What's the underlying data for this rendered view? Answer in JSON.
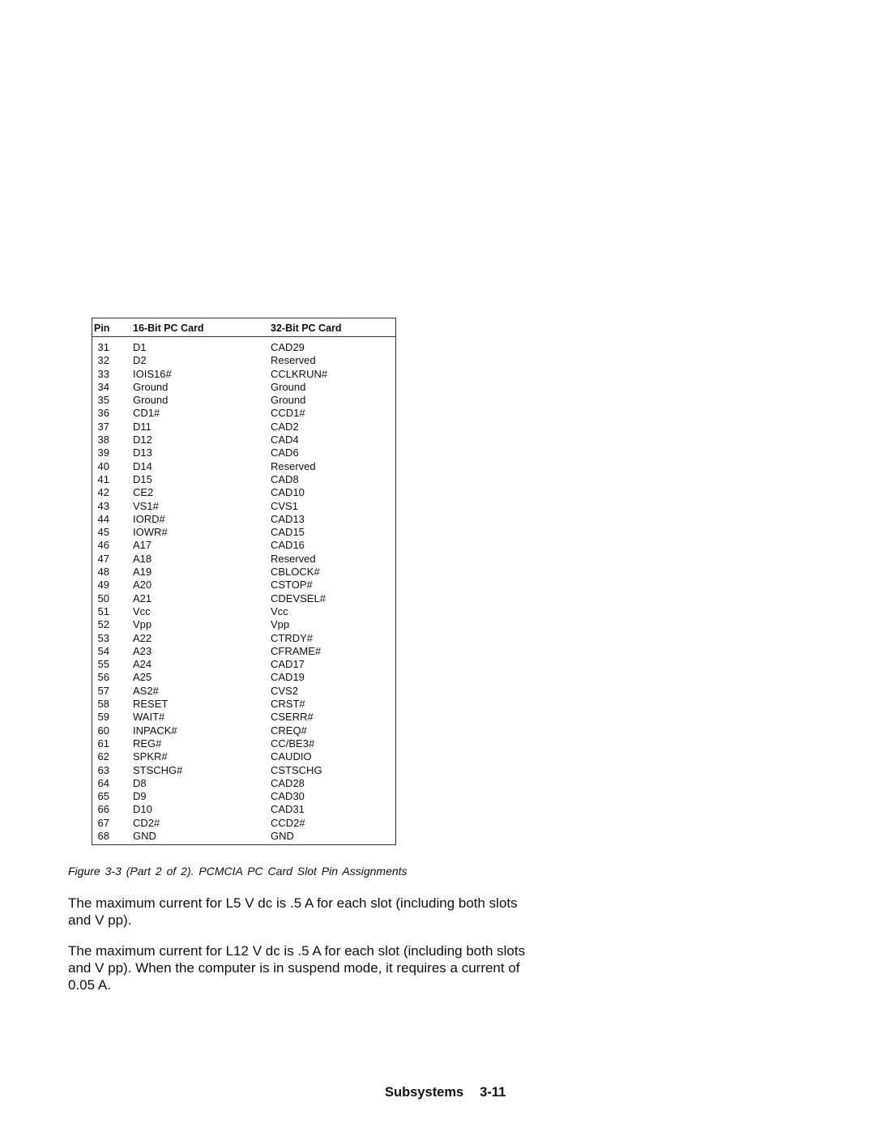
{
  "table": {
    "headers": {
      "pin": "Pin",
      "bit16": "16-Bit PC Card",
      "bit32": "32-Bit PC Card"
    },
    "rows": [
      {
        "pin": "31",
        "bit16": "D1",
        "bit32": "CAD29"
      },
      {
        "pin": "32",
        "bit16": "D2",
        "bit32": "Reserved"
      },
      {
        "pin": "33",
        "bit16": "IOIS16#",
        "bit32": "CCLKRUN#"
      },
      {
        "pin": "34",
        "bit16": "Ground",
        "bit32": "Ground"
      },
      {
        "pin": "35",
        "bit16": "Ground",
        "bit32": "Ground"
      },
      {
        "pin": "36",
        "bit16": "CD1#",
        "bit32": "CCD1#"
      },
      {
        "pin": "37",
        "bit16": "D11",
        "bit32": "CAD2"
      },
      {
        "pin": "38",
        "bit16": "D12",
        "bit32": "CAD4"
      },
      {
        "pin": "39",
        "bit16": "D13",
        "bit32": "CAD6"
      },
      {
        "pin": "40",
        "bit16": "D14",
        "bit32": "Reserved"
      },
      {
        "pin": "41",
        "bit16": "D15",
        "bit32": "CAD8"
      },
      {
        "pin": "42",
        "bit16": "CE2",
        "bit32": "CAD10"
      },
      {
        "pin": "43",
        "bit16": "VS1#",
        "bit32": "CVS1"
      },
      {
        "pin": "44",
        "bit16": "IORD#",
        "bit32": "CAD13"
      },
      {
        "pin": "45",
        "bit16": "IOWR#",
        "bit32": "CAD15"
      },
      {
        "pin": "46",
        "bit16": "A17",
        "bit32": "CAD16"
      },
      {
        "pin": "47",
        "bit16": "A18",
        "bit32": "Reserved"
      },
      {
        "pin": "48",
        "bit16": "A19",
        "bit32": "CBLOCK#"
      },
      {
        "pin": "49",
        "bit16": "A20",
        "bit32": "CSTOP#"
      },
      {
        "pin": "50",
        "bit16": "A21",
        "bit32": "CDEVSEL#"
      },
      {
        "pin": "51",
        "bit16": "Vcc",
        "bit32": "Vcc"
      },
      {
        "pin": "52",
        "bit16": "Vpp",
        "bit32": "Vpp"
      },
      {
        "pin": "53",
        "bit16": "A22",
        "bit32": "CTRDY#"
      },
      {
        "pin": "54",
        "bit16": "A23",
        "bit32": "CFRAME#"
      },
      {
        "pin": "55",
        "bit16": "A24",
        "bit32": "CAD17"
      },
      {
        "pin": "56",
        "bit16": "A25",
        "bit32": "CAD19"
      },
      {
        "pin": "57",
        "bit16": "AS2#",
        "bit32": "CVS2"
      },
      {
        "pin": "58",
        "bit16": "RESET",
        "bit32": "CRST#"
      },
      {
        "pin": "59",
        "bit16": "WAIT#",
        "bit32": "CSERR#"
      },
      {
        "pin": "60",
        "bit16": "INPACK#",
        "bit32": "CREQ#"
      },
      {
        "pin": "61",
        "bit16": "REG#",
        "bit32": "CC/BE3#"
      },
      {
        "pin": "62",
        "bit16": "SPKR#",
        "bit32": "CAUDIO"
      },
      {
        "pin": "63",
        "bit16": "STSCHG#",
        "bit32": "CSTSCHG"
      },
      {
        "pin": "64",
        "bit16": "D8",
        "bit32": "CAD28"
      },
      {
        "pin": "65",
        "bit16": "D9",
        "bit32": "CAD30"
      },
      {
        "pin": "66",
        "bit16": "D10",
        "bit32": "CAD31"
      },
      {
        "pin": "67",
        "bit16": "CD2#",
        "bit32": "CCD2#"
      },
      {
        "pin": "68",
        "bit16": "GND",
        "bit32": "GND"
      }
    ]
  },
  "caption": "Figure  3-3 (Part 2 of 2). PCMCIA PC Card Slot Pin Assignments",
  "paragraphs": [
    "The maximum current for L5 V dc is .5 A for each slot (including both slots and V pp).",
    "The maximum current for L12 V dc is .5 A for each slot (including both slots and V pp).  When the computer is in suspend mode, it requires a current of 0.05 A."
  ],
  "footer": {
    "section": "Subsystems",
    "page": "3-11"
  }
}
